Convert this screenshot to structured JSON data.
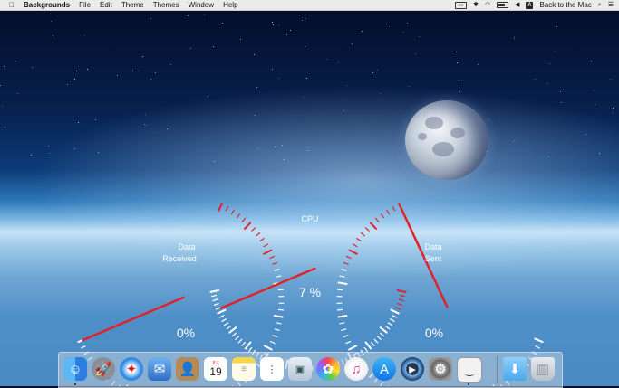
{
  "menubar": {
    "apple_icon": "apple-logo-icon",
    "app_name": "Backgrounds",
    "menus": [
      "File",
      "Edit",
      "Theme",
      "Themes",
      "Window",
      "Help"
    ],
    "right_text": "Back to the Mac",
    "status_icons": [
      "display-icon",
      "bluetooth-icon",
      "wifi-icon",
      "battery-icon",
      "volume-icon",
      "input-source-icon",
      "search-icon",
      "list-icon"
    ]
  },
  "gauges": {
    "received": {
      "label_line1": "Data",
      "label_line2": "Received",
      "value_text": "0%",
      "value": 0
    },
    "cpu": {
      "label": "CPU",
      "value_text": "7 %",
      "value": 7
    },
    "sent": {
      "label_line1": "Data",
      "label_line2": "Sent",
      "value_text": "0%",
      "value": 0
    }
  },
  "dock": {
    "calendar_month": "JUL",
    "calendar_day": "19",
    "apps": [
      "finder-icon",
      "launchpad-icon",
      "safari-icon",
      "mail-icon",
      "contacts-icon",
      "calendar-icon",
      "notes-icon",
      "reminders-icon",
      "preview-icon",
      "photos-icon",
      "itunes-icon",
      "app-store-icon",
      "quicktime-icon",
      "system-preferences-icon",
      "backgrounds-app-icon",
      "downloads-folder-icon",
      "trash-icon"
    ]
  }
}
